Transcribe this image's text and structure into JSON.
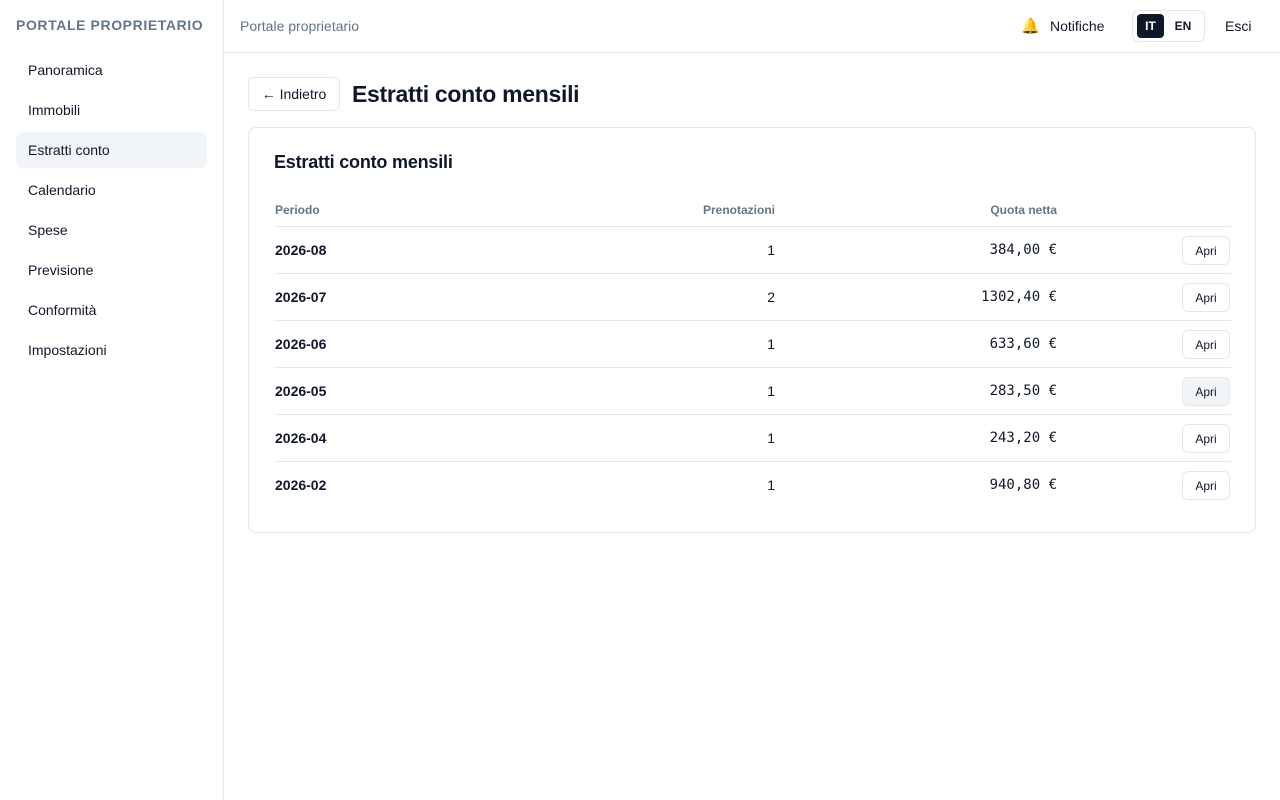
{
  "sidebar": {
    "brand": "PORTALE PROPRIETARIO",
    "items": [
      {
        "label": "Panoramica",
        "active": false
      },
      {
        "label": "Immobili",
        "active": false
      },
      {
        "label": "Estratti conto",
        "active": true
      },
      {
        "label": "Calendario",
        "active": false
      },
      {
        "label": "Spese",
        "active": false
      },
      {
        "label": "Previsione",
        "active": false
      },
      {
        "label": "Conformità",
        "active": false
      },
      {
        "label": "Impostazioni",
        "active": false
      }
    ]
  },
  "header": {
    "breadcrumb": "Portale proprietario",
    "notifications_icon": "bell-icon",
    "notifications_label": "Notifiche",
    "lang_it": "IT",
    "lang_en": "EN",
    "logout_label": "Esci"
  },
  "page": {
    "back_label": "← Indietro",
    "title": "Estratti conto mensili"
  },
  "card": {
    "title": "Estratti conto mensili",
    "columns": {
      "periodo": "Periodo",
      "prenotazioni": "Prenotazioni",
      "quota": "Quota netta"
    },
    "rows": [
      {
        "periodo": "2026-08",
        "prenotazioni": "1",
        "quota": "384,00 €",
        "action": "Apri"
      },
      {
        "periodo": "2026-07",
        "prenotazioni": "2",
        "quota": "1302,40 €",
        "action": "Apri"
      },
      {
        "periodo": "2026-06",
        "prenotazioni": "1",
        "quota": "633,60 €",
        "action": "Apri"
      },
      {
        "periodo": "2026-05",
        "prenotazioni": "1",
        "quota": "283,50 €",
        "action": "Apri"
      },
      {
        "periodo": "2026-04",
        "prenotazioni": "1",
        "quota": "243,20 €",
        "action": "Apri"
      },
      {
        "periodo": "2026-02",
        "prenotazioni": "1",
        "quota": "940,80 €",
        "action": "Apri"
      }
    ]
  },
  "colors": {
    "text": "#0f172a",
    "muted": "#64748b",
    "border": "#e5e7eb",
    "active_bg": "#f1f5f9",
    "lang_active_bg": "#0f172a"
  }
}
